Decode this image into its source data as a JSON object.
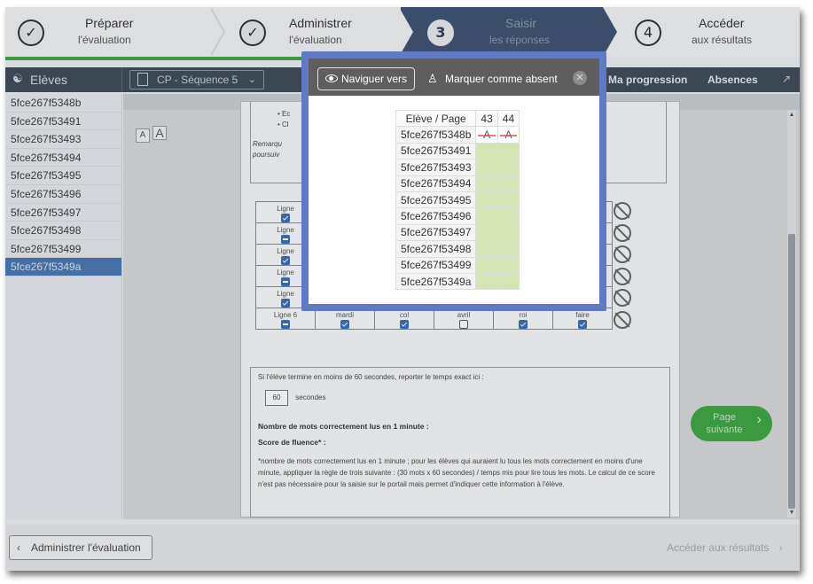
{
  "steps": [
    {
      "label1": "Préparer",
      "label2": "l'évaluation",
      "marker": "✓",
      "state": "done"
    },
    {
      "label1": "Administrer",
      "label2": "l'évaluation",
      "marker": "✓",
      "state": "done"
    },
    {
      "label1": "Saisir",
      "label2": "les réponses",
      "marker": "3",
      "state": "current"
    },
    {
      "label1": "Accéder",
      "label2": "aux résultats",
      "marker": "4",
      "state": "todo"
    }
  ],
  "toolbar": {
    "eleves_label": "Elèves",
    "sequence_value": "CP - Séquence 5",
    "ma_progression": "Ma progression",
    "absences": "Absences"
  },
  "students": [
    "5fce267f5348b",
    "5fce267f53491",
    "5fce267f53493",
    "5fce267f53494",
    "5fce267f53495",
    "5fce267f53496",
    "5fce267f53497",
    "5fce267f53498",
    "5fce267f53499",
    "5fce267f5349a"
  ],
  "selected_student": "5fce267f5349a",
  "font_buttons": {
    "small": "A",
    "large": "A"
  },
  "sheet": {
    "bullet1": "• Ec",
    "bullet2": "• Cl",
    "remarque": "Remarqu",
    "poursuivre": "poursuiv",
    "rows": [
      {
        "label": "Ligne",
        "words": [
          "",
          "",
          "",
          "",
          ""
        ],
        "checks": [
          "on",
          "on",
          "on",
          "on",
          "on",
          "on"
        ]
      },
      {
        "label": "Ligne",
        "words": [
          "",
          "",
          "",
          "",
          ""
        ],
        "checks": [
          "partial",
          "on",
          "on",
          "on",
          "on",
          "on"
        ]
      },
      {
        "label": "Ligne",
        "words": [
          "",
          "",
          "",
          "",
          ""
        ],
        "checks": [
          "on",
          "on",
          "on",
          "on",
          "on",
          "on"
        ]
      },
      {
        "label": "Ligne",
        "words": [
          "",
          "",
          "",
          "",
          ""
        ],
        "checks": [
          "partial",
          "on",
          "on",
          "on",
          "on",
          "on"
        ]
      },
      {
        "label": "Ligne",
        "words": [
          "",
          "",
          "",
          "",
          ""
        ],
        "checks": [
          "on",
          "on",
          "on",
          "on",
          "on",
          "on"
        ]
      },
      {
        "label": "Ligne 6",
        "words": [
          "mardi",
          "col",
          "avril",
          "roi",
          "faire"
        ],
        "checks": [
          "partial",
          "on",
          "on",
          "off",
          "on",
          "on"
        ]
      }
    ],
    "time_instruction": "Si l'élève termine en moins de 60 secondes, reporter le temps exact ici :",
    "time_value": "60",
    "seconds_label": "secondes",
    "mots_label": "Nombre de mots correctement lus en 1 minute :",
    "score_label": "Score de fluence* :",
    "footnote": "*nombre de mots correctement lus en 1 minute ; pour les élèves qui auraient lu tous les mots correctement en moins d'une minute, appliquer la règle de trois suivante : (30 mots x 60 secondes) / temps mis pour lire tous les mots. Le calcul de ce score n'est pas nécessaire pour la saisie sur le portail mais permet d'indiquer cette information à l'élève."
  },
  "next_page_label": "Page suivante",
  "footer": {
    "back_label": "Administrer l'évaluation",
    "results_label": "Accéder aux résultats"
  },
  "modal": {
    "nav_label": "Naviguer vers",
    "absent_label": "Marquer comme absent",
    "header_col": "Elève / Page",
    "pages": [
      "43",
      "44"
    ],
    "absent_mark": "A",
    "rows": [
      "5fce267f5348b",
      "5fce267f53491",
      "5fce267f53493",
      "5fce267f53494",
      "5fce267f53495",
      "5fce267f53496",
      "5fce267f53497",
      "5fce267f53498",
      "5fce267f53499",
      "5fce267f5349a"
    ],
    "absent_row": "5fce267f5348b"
  },
  "colors": {
    "accent_green": "#3ea640",
    "nav_dark": "#3f4a57",
    "step_current": "#3d5170",
    "selected_blue": "#4a78b0",
    "modal_border": "#5e79c6",
    "cell_green": "#d4e4b4"
  }
}
